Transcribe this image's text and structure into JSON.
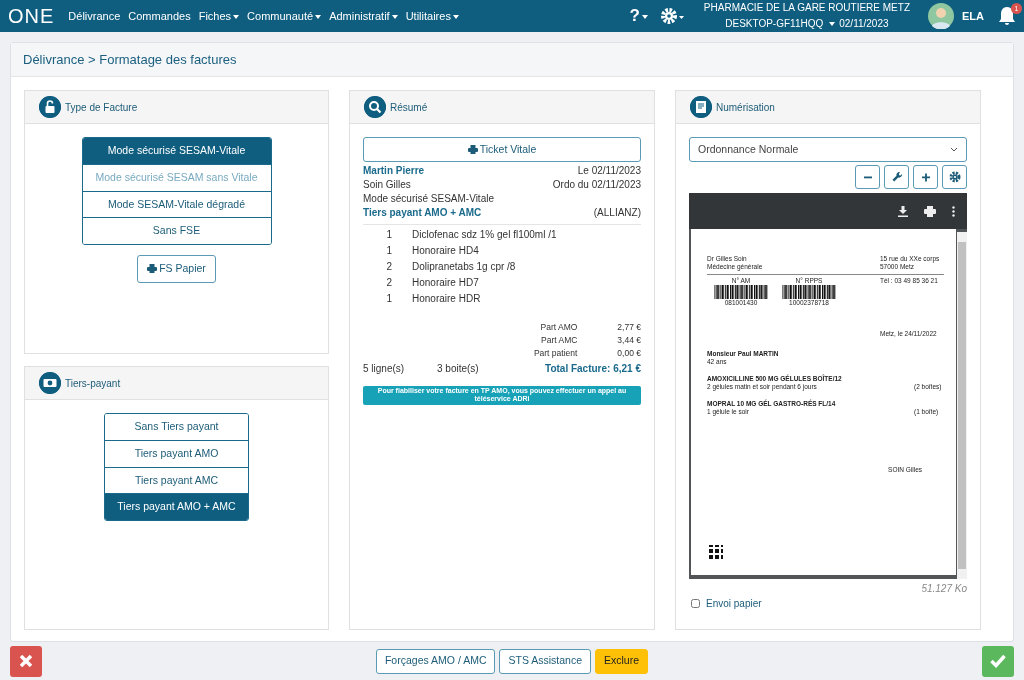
{
  "nav": {
    "logo": "ONE",
    "items": [
      {
        "label": "Délivrance",
        "dropdown": false
      },
      {
        "label": "Commandes",
        "dropdown": false
      },
      {
        "label": "Fiches",
        "dropdown": true
      },
      {
        "label": "Communauté",
        "dropdown": true
      },
      {
        "label": "Administratif",
        "dropdown": true
      },
      {
        "label": "Utilitaires",
        "dropdown": true
      }
    ],
    "help": "?",
    "pharmacy": "PHARMACIE DE LA GARE ROUTIERE METZ",
    "workstation": "DESKTOP-GF11HQQ",
    "date": "02/11/2023",
    "user": "ELA",
    "notifications": "1"
  },
  "breadcrumb": "Délivrance > Formatage des factures",
  "type_facture": {
    "title": "Type de Facture",
    "options": [
      {
        "label": "Mode sécurisé SESAM-Vitale",
        "selected": true,
        "disabled": false
      },
      {
        "label": "Mode sécurisé SESAM sans Vitale",
        "selected": false,
        "disabled": true
      },
      {
        "label": "Mode SESAM-Vitale dégradé",
        "selected": false,
        "disabled": false
      },
      {
        "label": "Sans FSE",
        "selected": false,
        "disabled": false
      }
    ],
    "paper_button": "FS Papier"
  },
  "tiers_payant": {
    "title": "Tiers-payant",
    "options": [
      {
        "label": "Sans Tiers payant",
        "selected": false
      },
      {
        "label": "Tiers payant AMO",
        "selected": false
      },
      {
        "label": "Tiers payant AMC",
        "selected": false
      },
      {
        "label": "Tiers payant AMO + AMC",
        "selected": true
      }
    ]
  },
  "resume": {
    "title": "Résumé",
    "ticket_button": "Ticket Vitale",
    "patient": "Martin Pierre",
    "date": "Le 02/11/2023",
    "prescriber": "Soin Gilles",
    "ordo_date": "Ordo du 02/11/2023",
    "mode": "Mode sécurisé SESAM-Vitale",
    "tiers": "Tiers payant AMO + AMC",
    "insurer": "(ALLIANZ)",
    "lines": [
      {
        "qty": "1",
        "label": "Diclofenac sdz 1% gel fl100ml /1"
      },
      {
        "qty": "1",
        "label": "Honoraire HD4"
      },
      {
        "qty": "2",
        "label": "Dolipranetabs 1g cpr /8"
      },
      {
        "qty": "2",
        "label": "Honoraire HD7"
      },
      {
        "qty": "1",
        "label": "Honoraire HDR"
      }
    ],
    "parts": [
      {
        "label": "Part AMO",
        "value": "2,77 €"
      },
      {
        "label": "Part AMC",
        "value": "3,44 €"
      },
      {
        "label": "Part patient",
        "value": "0,00 €"
      }
    ],
    "line_count": "5 ligne(s)",
    "box_count": "3 boite(s)",
    "total": "Total Facture: 6,21 €",
    "notice": "Pour fiabiliser votre facture en TP AMO, vous pouvez effectuer un appel au téléservice ADRi"
  },
  "numerisation": {
    "title": "Numérisation",
    "select_value": "Ordonnance Normale",
    "document": {
      "doctor": [
        "Dr Gilles Soin",
        "Médecine générale"
      ],
      "address": [
        "15 rue du XXe corps",
        "57000 Metz"
      ],
      "barcodes": [
        {
          "label": "N° AM",
          "number": "081001430"
        },
        {
          "label": "N° RPPS",
          "number": "10002378718"
        }
      ],
      "phone": "Tél : 03 49 85 36 21",
      "place_date": "Metz, le 24/11/2022",
      "patient": "Monsieur Paul MARTIN",
      "age": "42 ans",
      "items": [
        {
          "name": "AMOXICILLINE 500 MG GÉLULES BOÎTE/12",
          "dosage": "2 gélules matin et soir pendant 6 jours",
          "qty": "(2 boîtes)"
        },
        {
          "name": "MOPRAL 10 MG GÉL GASTRO-RÉS FL/14",
          "dosage": "1 gélule le soir",
          "qty": "(1 boîte)"
        }
      ],
      "signature": "SOIN Gilles"
    },
    "file_size": "51.127 Ko",
    "paper": {
      "label": "Envoi papier",
      "checked": false
    }
  },
  "footer": {
    "buttons": [
      {
        "label": "Forçages AMO / AMC",
        "kind": "outline"
      },
      {
        "label": "STS Assistance",
        "kind": "outline"
      },
      {
        "label": "Exclure",
        "kind": "warning"
      }
    ]
  }
}
